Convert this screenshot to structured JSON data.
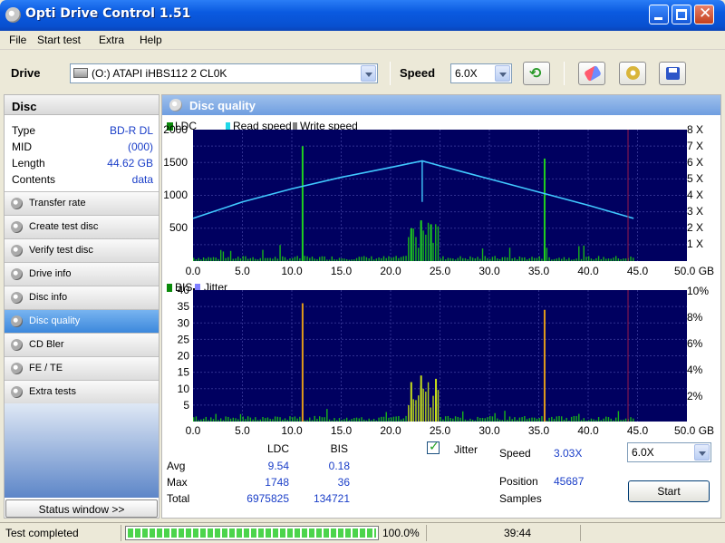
{
  "window": {
    "title": "Opti Drive Control 1.51"
  },
  "menu": [
    "File",
    "Start test",
    "Extra",
    "Help"
  ],
  "toolbar": {
    "drive_label": "Drive",
    "drive_value": "(O:)  ATAPI iHBS112  2 CL0K",
    "speed_label": "Speed",
    "speed_value": "6.0X"
  },
  "disc": {
    "header": "Disc",
    "fields": [
      {
        "key": "Type",
        "value": "BD-R DL"
      },
      {
        "key": "MID",
        "value": "(000)"
      },
      {
        "key": "Length",
        "value": "44.62 GB"
      },
      {
        "key": "Contents",
        "value": "data"
      }
    ]
  },
  "nav": [
    {
      "label": "Transfer rate",
      "active": false
    },
    {
      "label": "Create test disc",
      "active": false
    },
    {
      "label": "Verify test disc",
      "active": false
    },
    {
      "label": "Drive info",
      "active": false
    },
    {
      "label": "Disc info",
      "active": false
    },
    {
      "label": "Disc quality",
      "active": true
    },
    {
      "label": "CD Bler",
      "active": false
    },
    {
      "label": "FE / TE",
      "active": false
    },
    {
      "label": "Extra tests",
      "active": false
    }
  ],
  "status_window_label": "Status window >>",
  "panel_title": "Disc quality",
  "chart_data": [
    {
      "type": "line",
      "legend": [
        "LDC",
        "Read speed",
        "Write speed"
      ],
      "x_ticks": [
        "0.0",
        "5.0",
        "10.0",
        "15.0",
        "20.0",
        "25.0",
        "30.0",
        "35.0",
        "40.0",
        "45.0",
        "50.0 GB"
      ],
      "y_ticks_left": [
        "2000",
        "1500",
        "1000",
        "500"
      ],
      "y_ticks_right": [
        "8 X",
        "7 X",
        "6 X",
        "5 X",
        "4 X",
        "3 X",
        "2 X",
        "1 X"
      ],
      "xlim": [
        0,
        50
      ],
      "ylim": [
        0,
        2000
      ],
      "y2lim": [
        0,
        8
      ],
      "series": [
        {
          "name": "Read speed",
          "x": [
            0,
            5,
            10,
            15,
            20,
            23.2,
            25,
            30,
            35,
            40,
            44.6
          ],
          "y": [
            2.6,
            3.6,
            4.4,
            5.1,
            5.7,
            6.1,
            5.8,
            5.0,
            4.2,
            3.4,
            2.6
          ]
        },
        {
          "name": "LDC spikes",
          "x": [
            11.0,
            22.0,
            23.0,
            24.0,
            35.5
          ],
          "y": [
            1748,
            500,
            620,
            560,
            1560
          ]
        }
      ]
    },
    {
      "type": "line",
      "legend": [
        "BIS",
        "Jitter"
      ],
      "x_ticks": [
        "0.0",
        "5.0",
        "10.0",
        "15.0",
        "20.0",
        "25.0",
        "30.0",
        "35.0",
        "40.0",
        "45.0",
        "50.0 GB"
      ],
      "y_ticks_left": [
        "40",
        "35",
        "30",
        "25",
        "20",
        "15",
        "10",
        "5"
      ],
      "y_ticks_right": [
        "10%",
        "8%",
        "6%",
        "4%",
        "2%"
      ],
      "xlim": [
        0,
        50
      ],
      "ylim": [
        0,
        40
      ],
      "series": [
        {
          "name": "BIS spikes",
          "x": [
            11.0,
            22.0,
            23.0,
            24.5,
            35.5
          ],
          "y": [
            36,
            12,
            14,
            13,
            34
          ]
        }
      ]
    }
  ],
  "stats": {
    "col_ldc": "LDC",
    "col_bis": "BIS",
    "rows": [
      {
        "label": "Avg",
        "ldc": "9.54",
        "bis": "0.18"
      },
      {
        "label": "Max",
        "ldc": "1748",
        "bis": "36"
      },
      {
        "label": "Total",
        "ldc": "6975825",
        "bis": "134721"
      }
    ],
    "jitter_label": "Jitter",
    "speed_label": "Speed",
    "speed_value": "3.03X",
    "speed_select": "6.0X",
    "position_label": "Position",
    "position_value": "45687",
    "samples_label": "Samples",
    "start_label": "Start"
  },
  "statusbar": {
    "text": "Test completed",
    "progress": "100.0%",
    "time": "39:44"
  }
}
